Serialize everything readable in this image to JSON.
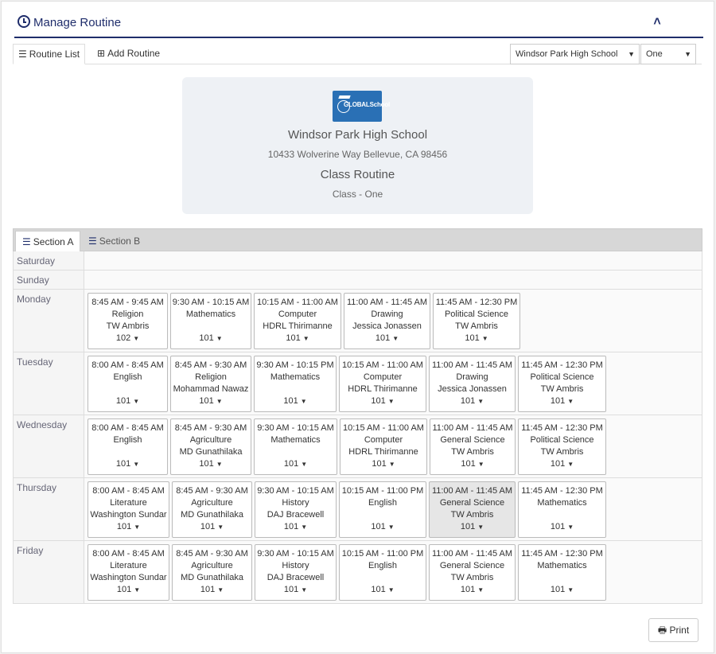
{
  "header": {
    "title": "Manage Routine",
    "collapse_icon": "chevron-up-icon"
  },
  "tabs": [
    {
      "label": "Routine List",
      "icon": "list-icon",
      "active": true
    },
    {
      "label": "Add Routine",
      "icon": "plus-square-icon",
      "active": false
    }
  ],
  "filters": {
    "school": "Windsor Park High School",
    "class": "One"
  },
  "school": {
    "logo_text": "GLOBALSchool",
    "name": "Windsor Park High School",
    "address": "10433 Wolverine Way Bellevue, CA 98456",
    "routine_title": "Class Routine",
    "class_label": "Class - One"
  },
  "sections": [
    {
      "label": "Section A",
      "active": true
    },
    {
      "label": "Section B",
      "active": false
    }
  ],
  "days": [
    {
      "name": "Saturday",
      "slots": []
    },
    {
      "name": "Sunday",
      "slots": []
    },
    {
      "name": "Monday",
      "slots": [
        {
          "time": "8:45 AM - 9:45 AM",
          "subject": "Religion",
          "teacher": "TW Ambris",
          "room": "102"
        },
        {
          "time": "9:30 AM - 10:15 AM",
          "subject": "Mathematics",
          "teacher": "",
          "room": "101"
        },
        {
          "time": "10:15 AM - 11:00 AM",
          "subject": "Computer",
          "teacher": "HDRL Thirimanne",
          "room": "101"
        },
        {
          "time": "11:00 AM - 11:45 AM",
          "subject": "Drawing",
          "teacher": "Jessica Jonassen",
          "room": "101"
        },
        {
          "time": "11:45 AM - 12:30 PM",
          "subject": "Political Science",
          "teacher": "TW Ambris",
          "room": "101"
        }
      ]
    },
    {
      "name": "Tuesday",
      "slots": [
        {
          "time": "8:00 AM - 8:45 AM",
          "subject": "English",
          "teacher": "",
          "room": "101"
        },
        {
          "time": "8:45 AM - 9:30 AM",
          "subject": "Religion",
          "teacher": "Mohammad Nawaz",
          "room": "101"
        },
        {
          "time": "9:30 AM - 10:15 PM",
          "subject": "Mathematics",
          "teacher": "",
          "room": "101"
        },
        {
          "time": "10:15 AM - 11:00 AM",
          "subject": "Computer",
          "teacher": "HDRL Thirimanne",
          "room": "101"
        },
        {
          "time": "11:00 AM - 11:45 AM",
          "subject": "Drawing",
          "teacher": "Jessica Jonassen",
          "room": "101"
        },
        {
          "time": "11:45 AM - 12:30 PM",
          "subject": "Political Science",
          "teacher": "TW Ambris",
          "room": "101"
        }
      ]
    },
    {
      "name": "Wednesday",
      "slots": [
        {
          "time": "8:00 AM - 8:45 AM",
          "subject": "English",
          "teacher": "",
          "room": "101"
        },
        {
          "time": "8:45 AM - 9:30 AM",
          "subject": "Agriculture",
          "teacher": "MD Gunathilaka",
          "room": "101"
        },
        {
          "time": "9:30 AM - 10:15 AM",
          "subject": "Mathematics",
          "teacher": "",
          "room": "101"
        },
        {
          "time": "10:15 AM - 11:00 AM",
          "subject": "Computer",
          "teacher": "HDRL Thirimanne",
          "room": "101"
        },
        {
          "time": "11:00 AM - 11:45 AM",
          "subject": "General Science",
          "teacher": "TW Ambris",
          "room": "101"
        },
        {
          "time": "11:45 AM - 12:30 PM",
          "subject": "Political Science",
          "teacher": "TW Ambris",
          "room": "101"
        }
      ]
    },
    {
      "name": "Thursday",
      "slots": [
        {
          "time": "8:00 AM - 8:45 AM",
          "subject": "Literature",
          "teacher": "Washington Sundar",
          "room": "101"
        },
        {
          "time": "8:45 AM - 9:30 AM",
          "subject": "Agriculture",
          "teacher": "MD Gunathilaka",
          "room": "101"
        },
        {
          "time": "9:30 AM - 10:15 AM",
          "subject": "History",
          "teacher": "DAJ Bracewell",
          "room": "101"
        },
        {
          "time": "10:15 AM - 11:00 PM",
          "subject": "English",
          "teacher": "",
          "room": "101"
        },
        {
          "time": "11:00 AM - 11:45 AM",
          "subject": "General Science",
          "teacher": "TW Ambris",
          "room": "101",
          "highlight": true
        },
        {
          "time": "11:45 AM - 12:30 PM",
          "subject": "Mathematics",
          "teacher": "",
          "room": "101"
        }
      ]
    },
    {
      "name": "Friday",
      "slots": [
        {
          "time": "8:00 AM - 8:45 AM",
          "subject": "Literature",
          "teacher": "Washington Sundar",
          "room": "101"
        },
        {
          "time": "8:45 AM - 9:30 AM",
          "subject": "Agriculture",
          "teacher": "MD Gunathilaka",
          "room": "101"
        },
        {
          "time": "9:30 AM - 10:15 AM",
          "subject": "History",
          "teacher": "DAJ Bracewell",
          "room": "101"
        },
        {
          "time": "10:15 AM - 11:00 PM",
          "subject": "English",
          "teacher": "",
          "room": "101"
        },
        {
          "time": "11:00 AM - 11:45 AM",
          "subject": "General Science",
          "teacher": "TW Ambris",
          "room": "101"
        },
        {
          "time": "11:45 AM - 12:30 PM",
          "subject": "Mathematics",
          "teacher": "",
          "room": "101"
        }
      ]
    }
  ],
  "actions": {
    "print_label": "Print",
    "print_icon": "printer-icon"
  },
  "colors": {
    "accent": "#1f2d6b",
    "logo_blue": "#2a70b5",
    "card_bg": "#eef1f5"
  }
}
